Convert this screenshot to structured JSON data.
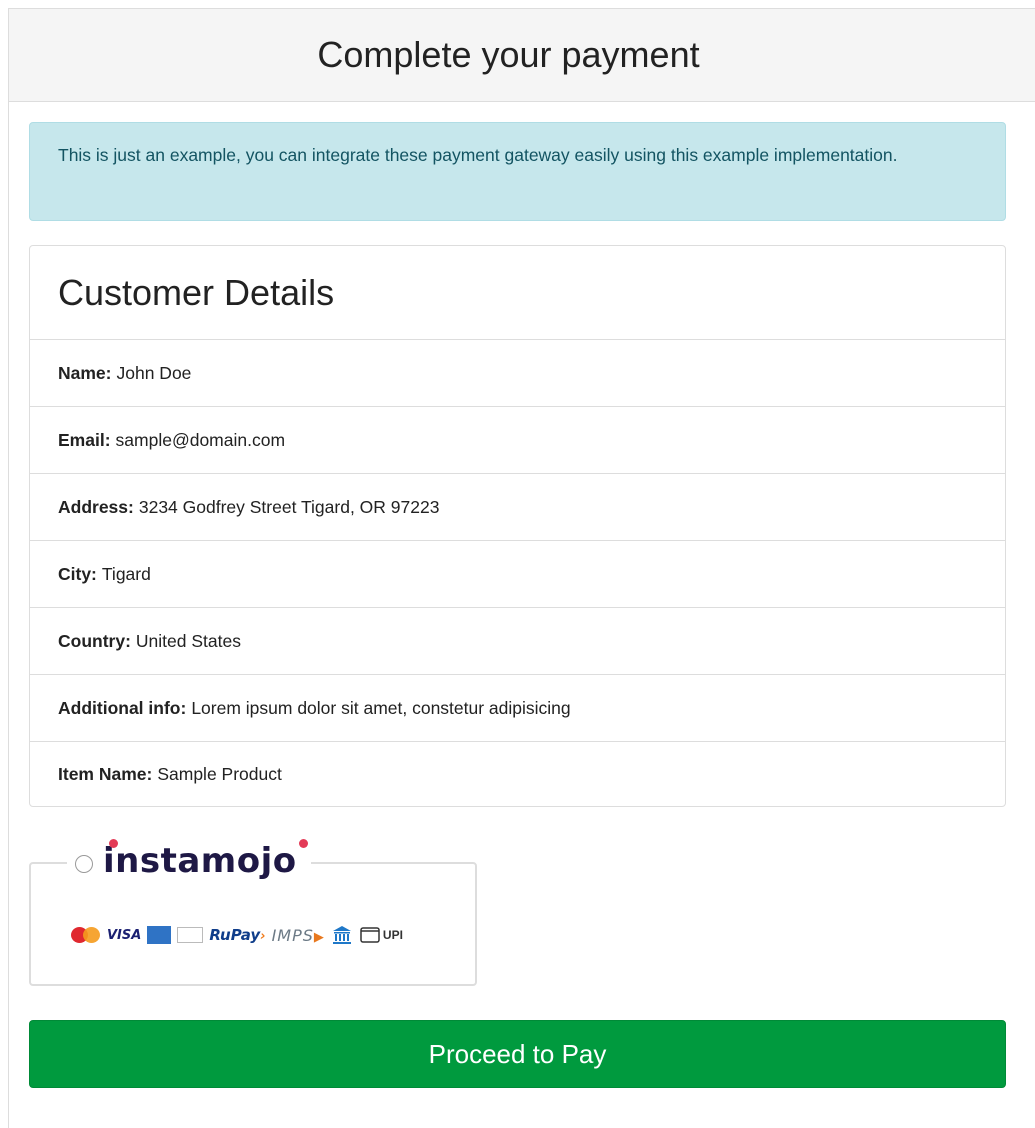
{
  "page": {
    "title": "Complete your payment"
  },
  "alert": {
    "text": "This is just an example, you can integrate these payment gateway easily using this example implementation."
  },
  "customer": {
    "heading": "Customer Details",
    "rows": [
      {
        "label": "Name:",
        "value": "John Doe"
      },
      {
        "label": "Email:",
        "value": "sample@domain.com"
      },
      {
        "label": "Address:",
        "value": "3234 Godfrey Street Tigard, OR 97223"
      },
      {
        "label": "City:",
        "value": "Tigard"
      },
      {
        "label": "Country:",
        "value": "United States"
      },
      {
        "label": "Additional info:",
        "value": "Lorem ipsum dolor sit amet, constetur adipisicing"
      },
      {
        "label": "Item Name:",
        "value": "Sample Product"
      }
    ]
  },
  "gateway": {
    "brand": "instamojo",
    "selected": false,
    "methods": {
      "visa": "VISA",
      "rupay": "RuPay",
      "imps": "IMPS",
      "upi": "UPI"
    },
    "icons": [
      "mastercard-icon",
      "visa-icon",
      "amex-icon",
      "discover-icon",
      "rupay-icon",
      "imps-icon",
      "netbanking-icon",
      "wallet-icon"
    ]
  },
  "actions": {
    "proceed_label": "Proceed to Pay"
  },
  "colors": {
    "alert_bg": "#c6e7ec",
    "alert_text": "#135462",
    "button_bg": "#009a3e",
    "brand_text": "#1e1845",
    "brand_dot": "#e33b57"
  }
}
